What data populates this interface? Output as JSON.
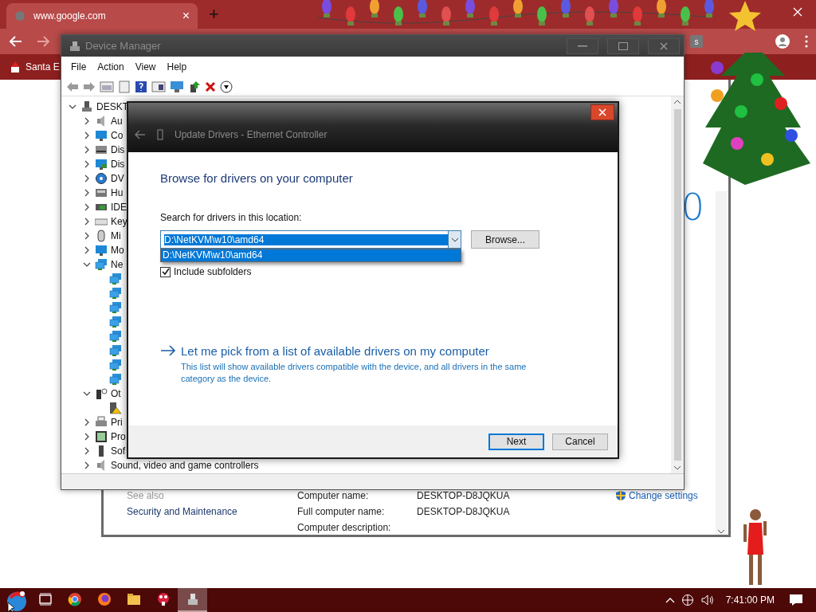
{
  "browser": {
    "tab_title": "www.google.com",
    "tab_close": "×",
    "new_tab": "+",
    "bookmark": "Santa E",
    "extension": "s"
  },
  "system_window": {
    "logo_fragment": "0",
    "see_also": "See also",
    "links": [
      "Security and Maintenance"
    ],
    "change_settings": "Change settings",
    "fields": [
      {
        "label": "Computer name:",
        "value": "DESKTOP-D8JQKUA"
      },
      {
        "label": "Full computer name:",
        "value": "DESKTOP-D8JQKUA"
      },
      {
        "label": "Computer description:"
      }
    ]
  },
  "device_manager": {
    "title": "Device Manager",
    "menu": [
      "File",
      "Action",
      "View",
      "Help"
    ],
    "tree": {
      "label": "DESKT",
      "kind": "root",
      "expanded": true,
      "children": [
        {
          "label": "Au",
          "kind": "audio",
          "expanded": false
        },
        {
          "label": "Co",
          "kind": "computer",
          "expanded": false
        },
        {
          "label": "Dis",
          "kind": "disk",
          "expanded": false
        },
        {
          "label": "Dis",
          "kind": "display",
          "expanded": false
        },
        {
          "label": "DV",
          "kind": "dvd",
          "expanded": false
        },
        {
          "label": "Hu",
          "kind": "hid",
          "expanded": false
        },
        {
          "label": "IDE",
          "kind": "ide",
          "expanded": false
        },
        {
          "label": "Key",
          "kind": "keyboard",
          "expanded": false
        },
        {
          "label": "Mi",
          "kind": "mouse",
          "expanded": false
        },
        {
          "label": "Mo",
          "kind": "monitor",
          "expanded": false
        },
        {
          "label": "Ne",
          "kind": "network",
          "expanded": true,
          "children": [
            {
              "kind": "network"
            },
            {
              "kind": "network"
            },
            {
              "kind": "network"
            },
            {
              "kind": "network"
            },
            {
              "kind": "network"
            },
            {
              "kind": "network"
            },
            {
              "kind": "network"
            },
            {
              "kind": "network"
            }
          ]
        },
        {
          "label": "Ot",
          "kind": "other",
          "expanded": true,
          "children": [
            {
              "kind": "warning"
            }
          ]
        },
        {
          "label": "Pri",
          "kind": "printer",
          "expanded": false
        },
        {
          "label": "Pro",
          "kind": "processor",
          "expanded": false
        },
        {
          "label": "Sof",
          "kind": "software",
          "expanded": false
        },
        {
          "label": "Sound, video and game controllers",
          "kind": "audio",
          "expanded": false
        }
      ]
    }
  },
  "dialog": {
    "title": "Update Drivers - Ethernet Controller",
    "heading": "Browse for drivers on your computer",
    "location_label": "Search for drivers in this location:",
    "location_value": "D:\\NetKVM\\w10\\amd64",
    "dropdown_items": [
      {
        "label": "D:\\NetKVM\\w10\\amd64",
        "selected": true
      }
    ],
    "browse": "Browse...",
    "include_subfolders": {
      "label": "Include subfolders",
      "checked": true
    },
    "pick_link": "Let me pick from a list of available drivers on my computer",
    "pick_description": "This list will show available drivers compatible with the device, and all drivers in the same category as the device.",
    "buttons": [
      {
        "label": "Next",
        "default": true
      },
      {
        "label": "Cancel",
        "default": false
      }
    ]
  },
  "taskbar": {
    "apps": [
      {
        "kind": "taskview",
        "active": false
      },
      {
        "kind": "chrome",
        "active": false
      },
      {
        "kind": "firefox",
        "active": false
      },
      {
        "kind": "explorer",
        "active": false
      },
      {
        "kind": "redapp",
        "active": false
      },
      {
        "kind": "devmgr",
        "active": true
      }
    ],
    "clock": "7:41:00 PM"
  }
}
